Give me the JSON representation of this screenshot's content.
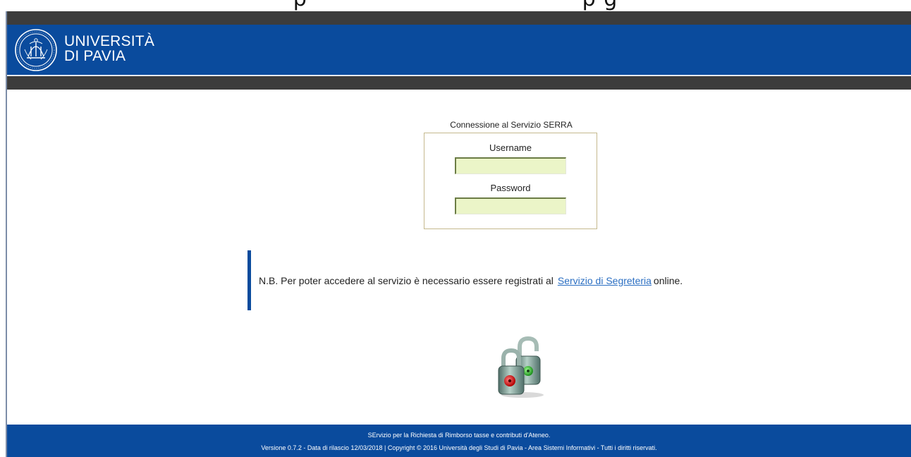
{
  "header": {
    "logo_line1": "UNIVERSITÀ",
    "logo_line2": "DI PAVIA"
  },
  "login": {
    "title": "Connessione al Servizio SERRA",
    "username_label": "Username",
    "username_value": "",
    "password_label": "Password",
    "password_value": ""
  },
  "notice": {
    "text_before": "N.B. Per poter accedere al servizio è necessario essere registrati al",
    "link_text": "Servizio di Segreteria",
    "text_after": "online."
  },
  "footer": {
    "line1": "SErvizio per la Richiesta di Rimborso tasse e contributi d'Ateneo.",
    "line2": "Versione 0.7.2 - Data di rilascio 12/03/2018 | Copyright © 2016 Università degli Studi di Pavia - Area Sistemi Informativi - Tutti i diritti riservati."
  },
  "colors": {
    "brand_blue": "#0a4b9d",
    "dark_strip": "#3c3c3c",
    "input_bg": "#ebf5c8",
    "link": "#2a6ec2"
  },
  "icons": {
    "seal": "university-seal-icon",
    "padlocks": "padlocks-icon"
  }
}
